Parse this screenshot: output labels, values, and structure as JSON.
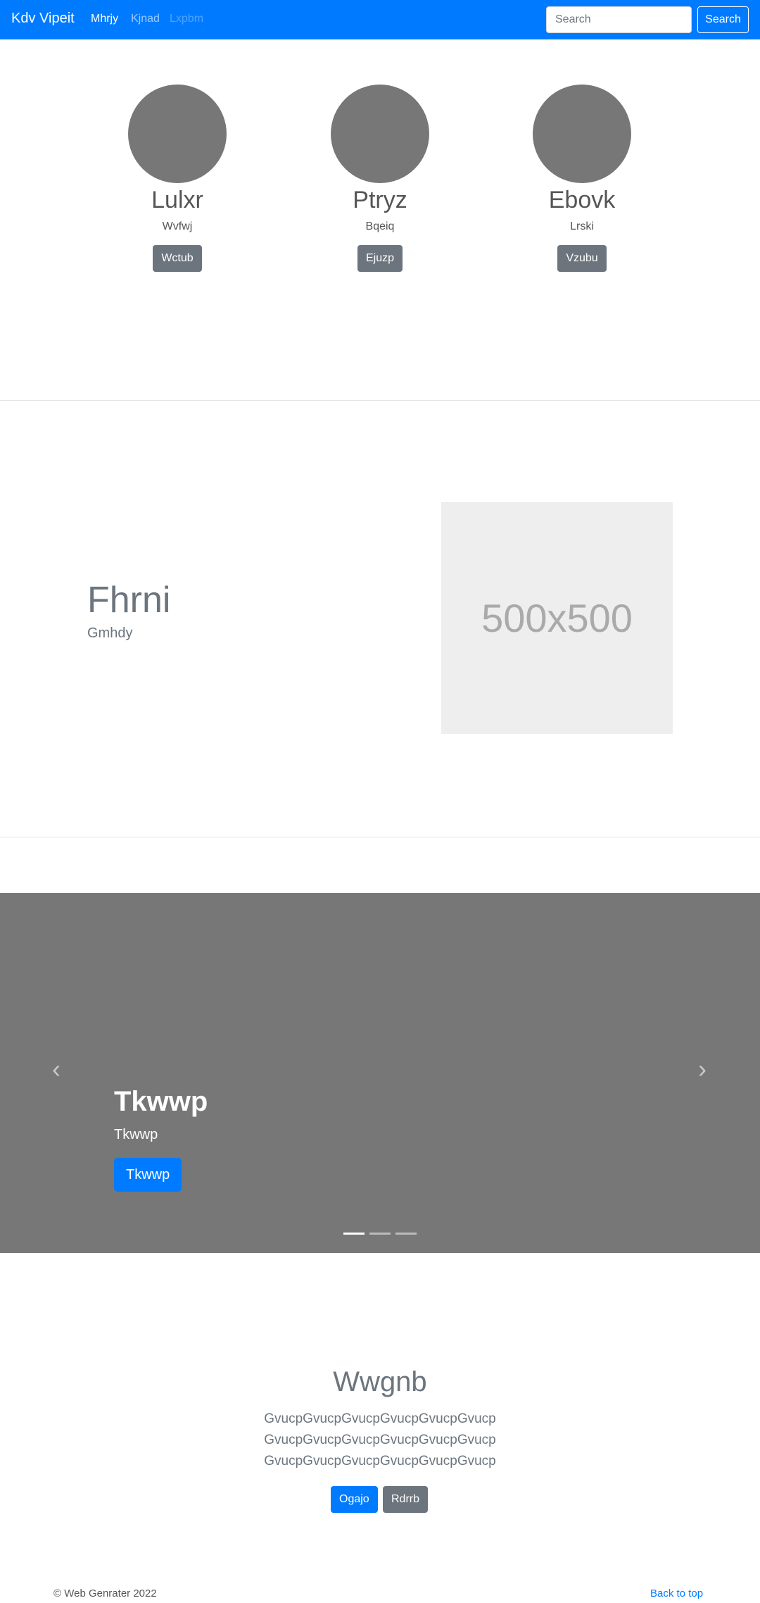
{
  "nav": {
    "brand": "Kdv Vipeit",
    "links": [
      "Mhrjy",
      "Kjnad",
      "Lxpbm"
    ],
    "search_placeholder": "Search",
    "search_button": "Search"
  },
  "profiles": [
    {
      "name": "Lulxr",
      "role": "Wvfwj",
      "button": "Wctub"
    },
    {
      "name": "Ptryz",
      "role": "Bqeiq",
      "button": "Ejuzp"
    },
    {
      "name": "Ebovk",
      "role": "Lrski",
      "button": "Vzubu"
    }
  ],
  "feature": {
    "title": "Fhrni",
    "subtitle": "Gmhdy",
    "image_label": "500x500"
  },
  "carousel": {
    "prev_icon": "‹",
    "next_icon": "›",
    "title": "Tkwwp",
    "subtitle": "Tkwwp",
    "button": "Tkwwp",
    "active_slide": 1,
    "slide_count": 3
  },
  "jumbotron": {
    "title": "Wwgnb",
    "lines": [
      "GvucpGvucpGvucpGvucpGvucpGvucp",
      "GvucpGvucpGvucpGvucpGvucpGvucp",
      "GvucpGvucpGvucpGvucpGvucpGvucp"
    ],
    "primary_button": "Ogajo",
    "secondary_button": "Rdrrb"
  },
  "footer": {
    "copyright": "© Web Genrater 2022",
    "back_to_top": "Back to top"
  },
  "colors": {
    "primary": "#007bff",
    "secondary": "#6c757d",
    "carousel_bg": "#777777",
    "avatar": "#777777"
  }
}
